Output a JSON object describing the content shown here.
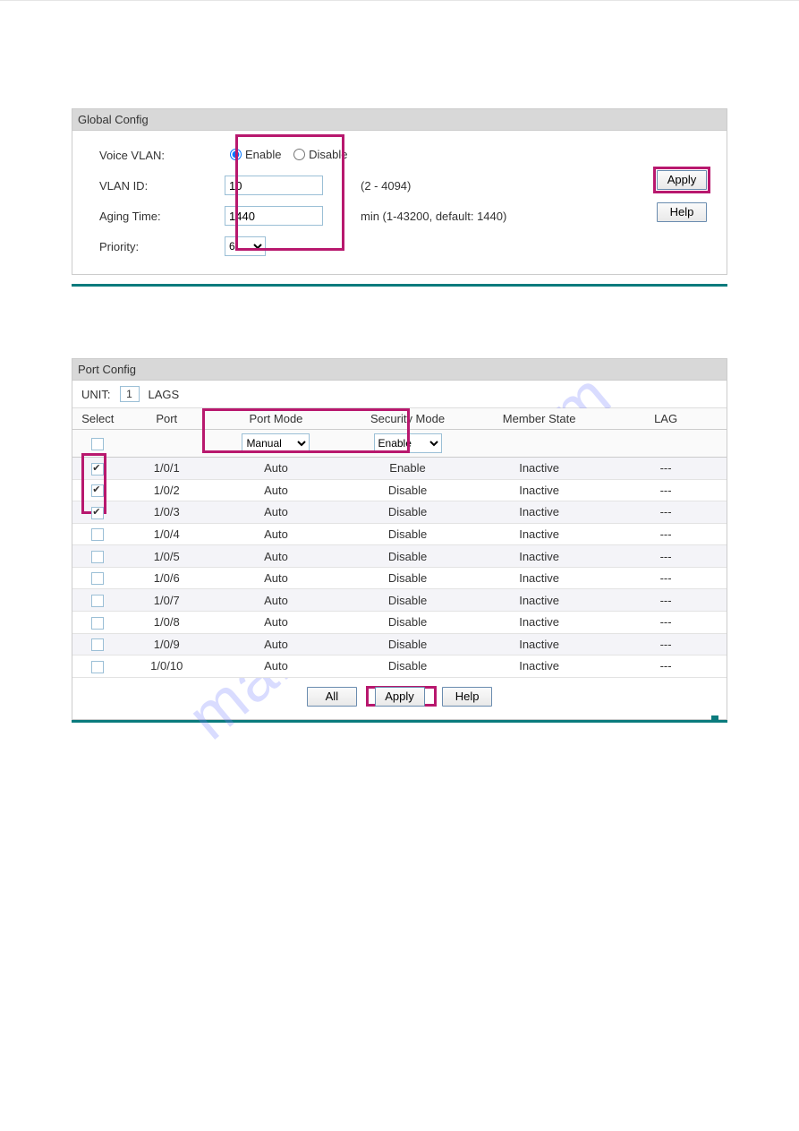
{
  "global": {
    "title": "Global Config",
    "labels": {
      "voice_vlan": "Voice VLAN:",
      "vlan_id": "VLAN ID:",
      "aging_time": "Aging Time:",
      "priority": "Priority:"
    },
    "radio": {
      "enable": "Enable",
      "disable": "Disable"
    },
    "values": {
      "vlan_id": "10",
      "aging_time": "1440",
      "priority": "6"
    },
    "hints": {
      "vlan_id": "(2 - 4094)",
      "aging_time": "min (1-43200, default: 1440)"
    },
    "buttons": {
      "apply": "Apply",
      "help": "Help"
    }
  },
  "port": {
    "title": "Port Config",
    "unit_label": "UNIT:",
    "unit_value": "1",
    "lags_label": "LAGS",
    "headers": {
      "select": "Select",
      "port": "Port",
      "port_mode": "Port Mode",
      "security_mode": "Security Mode",
      "member_state": "Member State",
      "lag": "LAG"
    },
    "selects": {
      "port_mode": "Manual",
      "security_mode": "Enable"
    },
    "rows": [
      {
        "checked": true,
        "port": "1/0/1",
        "mode": "Auto",
        "sec": "Enable",
        "mem": "Inactive",
        "lag": "---",
        "hl": true
      },
      {
        "checked": true,
        "port": "1/0/2",
        "mode": "Auto",
        "sec": "Disable",
        "mem": "Inactive",
        "lag": "---",
        "hl": true
      },
      {
        "checked": true,
        "port": "1/0/3",
        "mode": "Auto",
        "sec": "Disable",
        "mem": "Inactive",
        "lag": "---",
        "hl": true
      },
      {
        "checked": false,
        "port": "1/0/4",
        "mode": "Auto",
        "sec": "Disable",
        "mem": "Inactive",
        "lag": "---",
        "hl": false
      },
      {
        "checked": false,
        "port": "1/0/5",
        "mode": "Auto",
        "sec": "Disable",
        "mem": "Inactive",
        "lag": "---",
        "hl": false
      },
      {
        "checked": false,
        "port": "1/0/6",
        "mode": "Auto",
        "sec": "Disable",
        "mem": "Inactive",
        "lag": "---",
        "hl": false
      },
      {
        "checked": false,
        "port": "1/0/7",
        "mode": "Auto",
        "sec": "Disable",
        "mem": "Inactive",
        "lag": "---",
        "hl": false
      },
      {
        "checked": false,
        "port": "1/0/8",
        "mode": "Auto",
        "sec": "Disable",
        "mem": "Inactive",
        "lag": "---",
        "hl": false
      },
      {
        "checked": false,
        "port": "1/0/9",
        "mode": "Auto",
        "sec": "Disable",
        "mem": "Inactive",
        "lag": "---",
        "hl": false
      },
      {
        "checked": false,
        "port": "1/0/10",
        "mode": "Auto",
        "sec": "Disable",
        "mem": "Inactive",
        "lag": "---",
        "hl": false
      }
    ],
    "buttons": {
      "all": "All",
      "apply": "Apply",
      "help": "Help"
    }
  },
  "watermark": "manualshive.com"
}
